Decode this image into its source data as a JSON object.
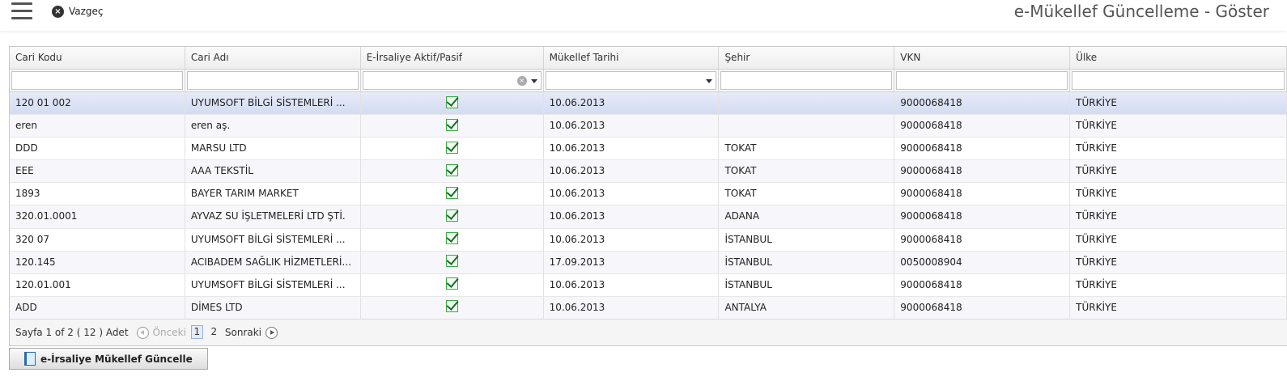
{
  "toolbar": {
    "cancel_label": "Vazgeç",
    "title": "e-Mükellef Güncelleme - Göster"
  },
  "grid": {
    "columns": [
      "Cari Kodu",
      "Cari Adı",
      "E-İrsaliye Aktif/Pasif",
      "Mükellef Tarihi",
      "Şehir",
      "VKN",
      "Ülke"
    ],
    "rows": [
      {
        "code": "120 01 002",
        "name": "UYUMSOFT BİLGİ SİSTEMLERİ ...",
        "active": true,
        "date": "10.06.2013",
        "city": "",
        "vkn": "9000068418",
        "country": "TÜRKİYE"
      },
      {
        "code": "eren",
        "name": "eren aş.",
        "active": true,
        "date": "10.06.2013",
        "city": "",
        "vkn": "9000068418",
        "country": "TÜRKİYE"
      },
      {
        "code": "DDD",
        "name": "MARSU LTD",
        "active": true,
        "date": "10.06.2013",
        "city": "TOKAT",
        "vkn": "9000068418",
        "country": "TÜRKİYE"
      },
      {
        "code": "EEE",
        "name": "AAA TEKSTİL",
        "active": true,
        "date": "10.06.2013",
        "city": "TOKAT",
        "vkn": "9000068418",
        "country": "TÜRKİYE"
      },
      {
        "code": "1893",
        "name": "BAYER TARIM MARKET",
        "active": true,
        "date": "10.06.2013",
        "city": "TOKAT",
        "vkn": "9000068418",
        "country": "TÜRKİYE"
      },
      {
        "code": "320.01.0001",
        "name": "AYVAZ SU İŞLETMELERİ LTD ŞTİ.",
        "active": true,
        "date": "10.06.2013",
        "city": "ADANA",
        "vkn": "9000068418",
        "country": "TÜRKİYE"
      },
      {
        "code": "320 07",
        "name": "UYUMSOFT BİLGİ SİSTEMLERİ ...",
        "active": true,
        "date": "10.06.2013",
        "city": "İSTANBUL",
        "vkn": "9000068418",
        "country": "TÜRKİYE"
      },
      {
        "code": "120.145",
        "name": "ACIBADEM SAĞLIK HİZMETLERİ...",
        "active": true,
        "date": "17.09.2013",
        "city": "İSTANBUL",
        "vkn": "0050008904",
        "country": "TÜRKİYE"
      },
      {
        "code": "120.01.001",
        "name": "UYUMSOFT BİLGİ SİSTEMLERİ ...",
        "active": true,
        "date": "10.06.2013",
        "city": "İSTANBUL",
        "vkn": "9000068418",
        "country": "TÜRKİYE"
      },
      {
        "code": "ADD",
        "name": "DİMES LTD",
        "active": true,
        "date": "10.06.2013",
        "city": "ANTALYA",
        "vkn": "9000068418",
        "country": "TÜRKİYE"
      }
    ]
  },
  "pager": {
    "info": "Sayfa 1 of 2 ( 12 ) Adet",
    "prev_label": "Önceki",
    "pages": [
      "1",
      "2"
    ],
    "current_page": "1",
    "next_label": "Sonraki"
  },
  "action": {
    "update_label": "e-İrsaliye Mükellef Güncelle"
  },
  "colors": {
    "selected_row": "#dbe2f6",
    "check_green": "#3da946"
  }
}
